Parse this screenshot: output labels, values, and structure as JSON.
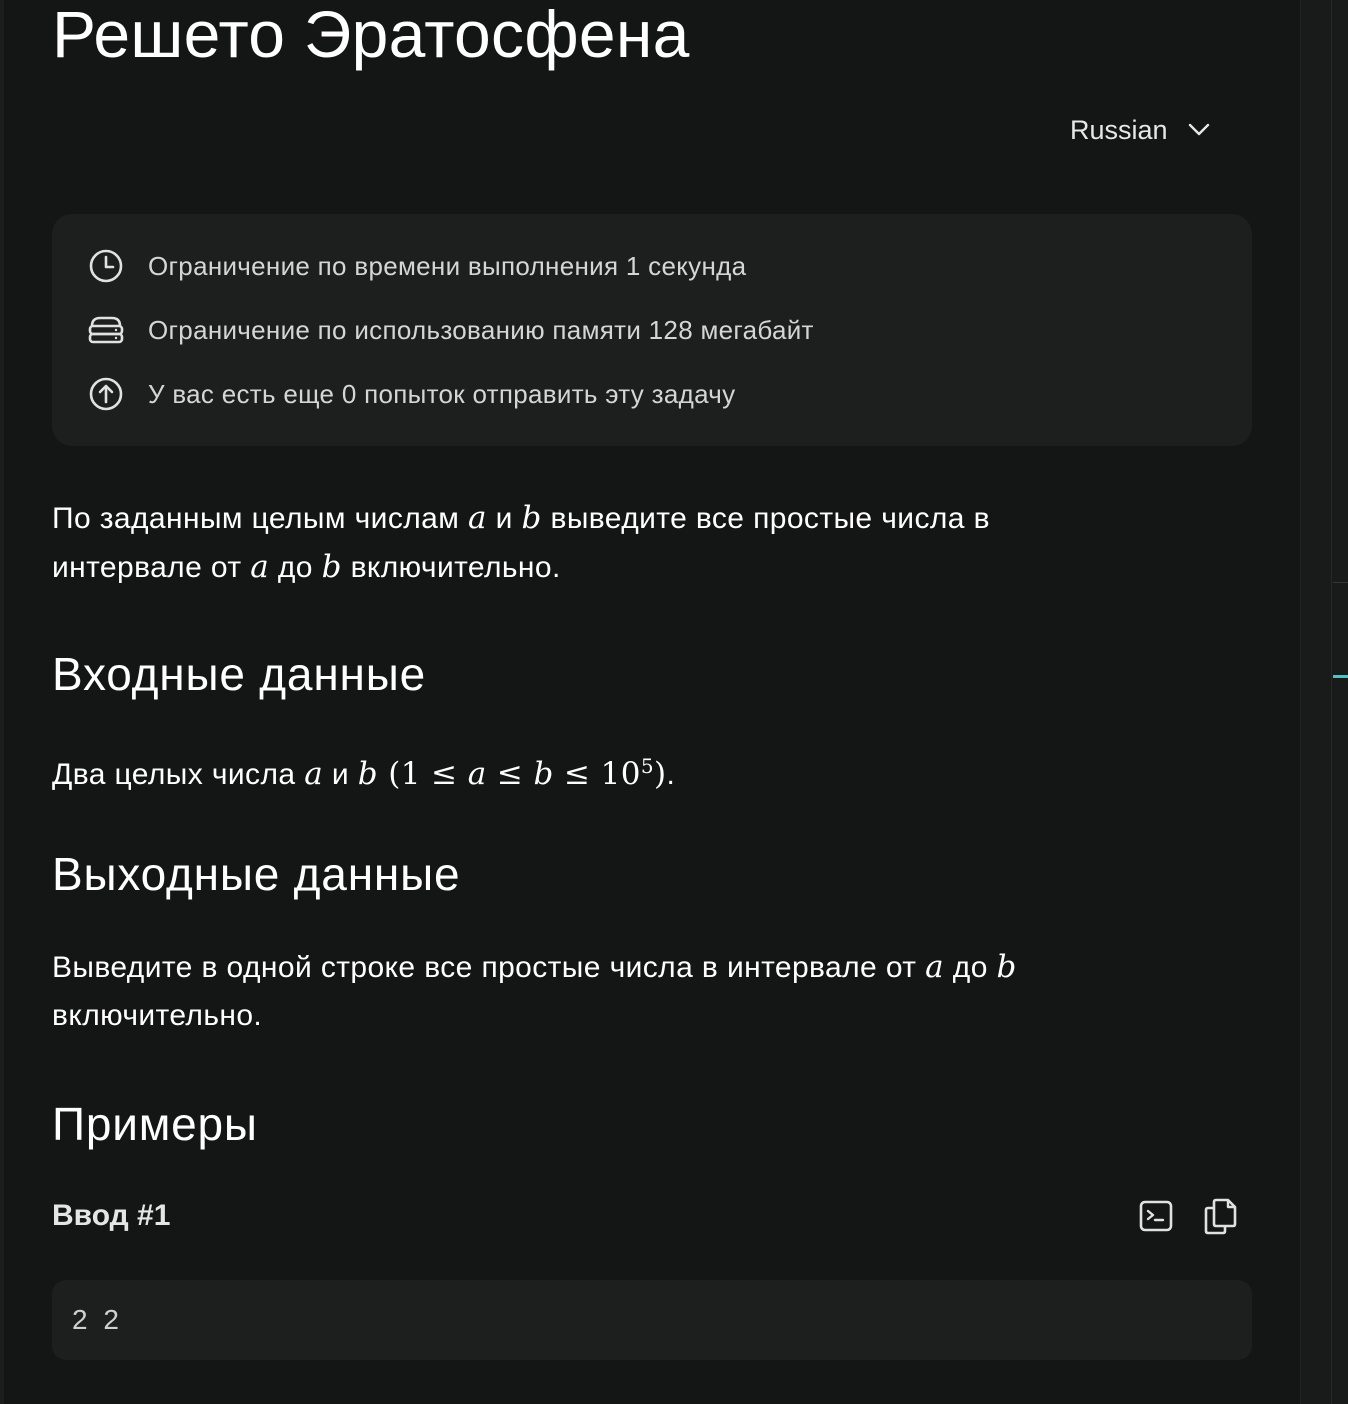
{
  "problem": {
    "title": "Решето Эратосфена"
  },
  "language_select": {
    "value": "Russian",
    "icon": "chevron-down-icon"
  },
  "limits": [
    {
      "icon": "clock-icon",
      "text": "Ограничение по времени выполнения 1 секунда"
    },
    {
      "icon": "memory-icon",
      "text": "Ограничение по использованию памяти 128 мегабайт"
    },
    {
      "icon": "upload-arrow-icon",
      "text": "У вас есть еще 0 попыток отправить эту задачу"
    }
  ],
  "statement": {
    "part1": "По заданным целым числам ",
    "var_a": "a",
    "and": " и ",
    "var_b": "b",
    "part2": " выведите все простые числа в",
    "part3": "интервале от ",
    "to": " до ",
    "part4": " включительно."
  },
  "input_section": {
    "heading": "Входные данные",
    "text1": "Два целых числа ",
    "var_a": "a",
    "and": " и ",
    "var_b": "b",
    "constraint_open": " (1 ≤ ",
    "le1": " ≤ ",
    "le2": " ≤ 10",
    "sup": "5",
    "constraint_close": ")",
    "period": "."
  },
  "output_section": {
    "heading": "Выходные данные",
    "text1": "Выведите в одной строке все простые числа в интервале от ",
    "var_a": "a",
    "to": " до ",
    "var_b": "b",
    "text2": "включительно."
  },
  "examples": {
    "heading": "Примеры",
    "input_label": "Ввод #1",
    "input_value": "2 2",
    "run_icon": "terminal-icon",
    "copy_icon": "copy-icon"
  }
}
